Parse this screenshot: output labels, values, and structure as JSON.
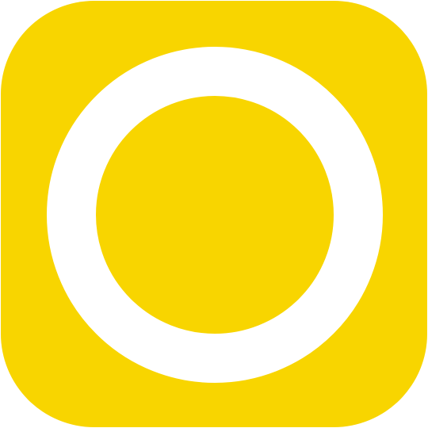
{
  "app_icon": {
    "icon_name": "ring-circle-icon",
    "colors": {
      "background": "#f8d500",
      "ring": "#ffffff",
      "center": "#f8d500",
      "page": "#ffffff"
    }
  }
}
